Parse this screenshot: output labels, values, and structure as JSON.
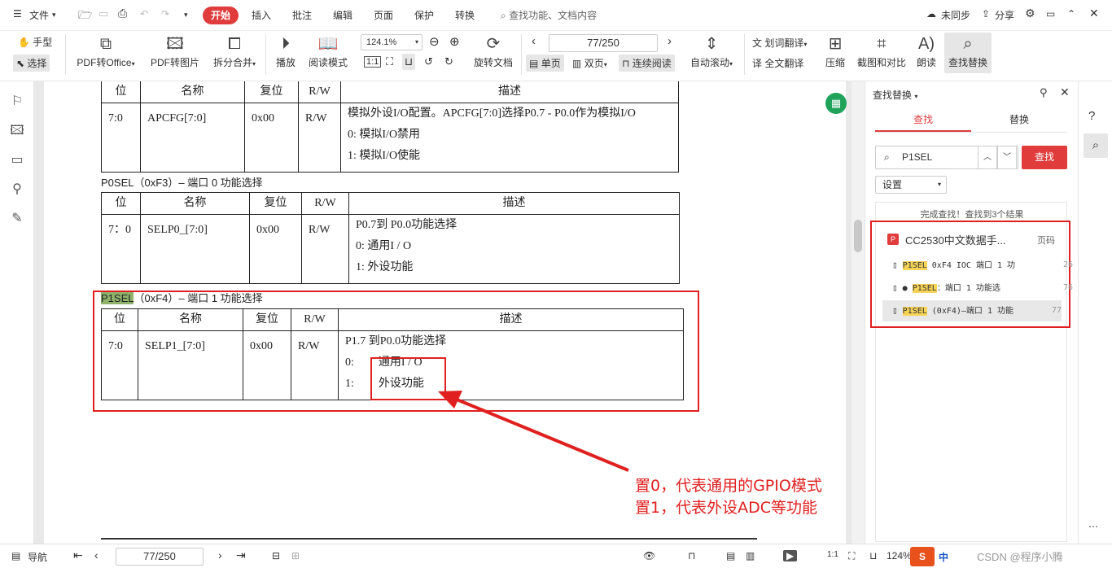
{
  "menubar": {
    "items": [
      "文件",
      "开始",
      "插入",
      "批注",
      "编辑",
      "页面",
      "保护",
      "转换"
    ],
    "search_placeholder": "查找功能、文档内容",
    "sync_label": "未同步",
    "share_label": "分享"
  },
  "ribbon": {
    "hand_tool": "手型",
    "select_tool": "选择",
    "pdf_to_office": "PDF转Office",
    "pdf_to_image": "PDF转图片",
    "split_merge": "拆分合并",
    "play": "播放",
    "read_mode": "阅读模式",
    "zoom_value": "124.1%",
    "page_value": "77/250",
    "rotate_doc": "旋转文档",
    "single_page": "单页",
    "double_page": "双页",
    "continuous_read": "连续阅读",
    "auto_scroll": "自动滚动",
    "word_translate": "划词翻译",
    "full_translate": "全文翻译",
    "compress": "压缩",
    "crop_compare": "截图和对比",
    "read_aloud": "朗读",
    "find_replace": "查找替换"
  },
  "document": {
    "table1": {
      "headers": [
        "位",
        "名称",
        "复位",
        "R/W",
        "描述"
      ],
      "row": {
        "bit": "7:0",
        "name": "APCFG[7:0]",
        "reset": "0x00",
        "rw": "R/W"
      },
      "desc": [
        "模拟外设I/O配置。APCFG[7:0]选择P0.7 - P0.0作为模拟I/O",
        "0:      模拟I/O禁用",
        "1:      模拟I/O使能"
      ]
    },
    "section2_title": "P0SEL（0xF3）– 端口 0 功能选择",
    "table2": {
      "headers": [
        "位",
        "名称",
        "复位",
        "R/W",
        "描述"
      ],
      "row": {
        "bit": "7：0",
        "name": "SELP0_[7:0]",
        "reset": "0x00",
        "rw": "R/W"
      },
      "desc": [
        "P0.7到  P0.0功能选择",
        "0:        通用I / O",
        "1:        外设功能"
      ]
    },
    "section3_title_hl": "P1SEL",
    "section3_title_rest": "（0xF4）– 端口 1 功能选择",
    "table3": {
      "headers": [
        "位",
        "名称",
        "复位",
        "R/W",
        "描述"
      ],
      "row": {
        "bit": "7:0",
        "name": "SELP1_[7:0]",
        "reset": "0x00",
        "rw": "R/W"
      },
      "desc": [
        "P1.7  到P0.0功能选择",
        "0:",
        "1:"
      ],
      "opt0": "通用I / O",
      "opt1": "外设功能"
    },
    "annotation_line1": "置0，代表通用的GPIO模式",
    "annotation_line2": "置1，代表外设ADC等功能"
  },
  "find_panel": {
    "title": "查找替换",
    "tab_find": "查找",
    "tab_replace": "替换",
    "query": "P1SEL",
    "find_button": "查找",
    "settings": "设置",
    "result_summary": "完成查找！查找到3个结果",
    "doc_name": "CC2530中文数据手...",
    "page_col": "页码",
    "results": [
      {
        "hl": "P1SEL",
        "rest": " 0xF4 IOC 端口 1 功",
        "page": "26"
      },
      {
        "hl": "P1SEL",
        "rest": "：端口 1 功能选",
        "page": "76"
      },
      {
        "hl": "P1SEL",
        "rest": " (0xF4)–端口 1 功能",
        "page": "77"
      }
    ]
  },
  "statusbar": {
    "nav_label": "导航",
    "page_value": "77/250",
    "zoom_value": "124%",
    "ime_label": "中"
  },
  "watermark": "CSDN @程序小腾",
  "colors": {
    "accent": "#e03c3c",
    "annotation": "#e02020",
    "highlight_green": "#8fb26b",
    "highlight_yellow": "#f7d358"
  }
}
